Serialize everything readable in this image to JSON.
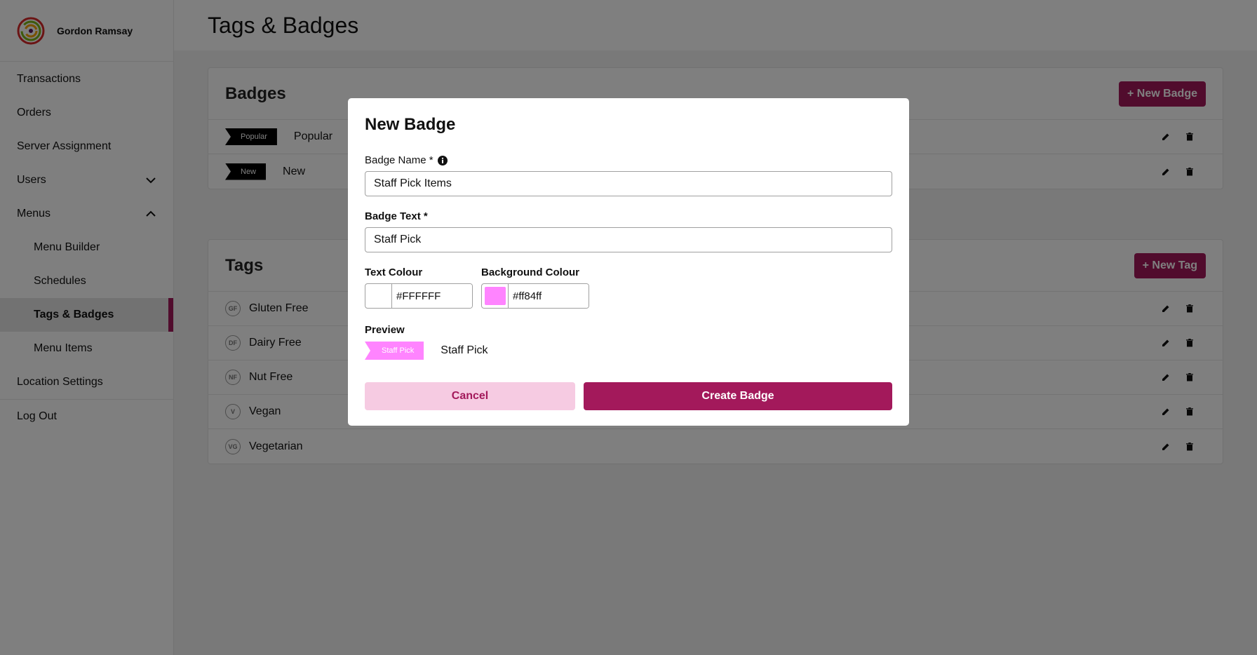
{
  "brand": {
    "name": "Gordon Ramsay"
  },
  "sidebar": {
    "items": [
      {
        "label": "Transactions"
      },
      {
        "label": "Orders"
      },
      {
        "label": "Server Assignment"
      },
      {
        "label": "Users"
      },
      {
        "label": "Menus"
      },
      {
        "label": "Menu Builder"
      },
      {
        "label": "Schedules"
      },
      {
        "label": "Tags & Badges"
      },
      {
        "label": "Menu Items"
      },
      {
        "label": "Location Settings"
      },
      {
        "label": "Log Out"
      }
    ]
  },
  "header": {
    "title": "Tags & Badges"
  },
  "badges": {
    "title": "Badges",
    "new_button": "+ New Badge",
    "rows": [
      {
        "badge_text": "Popular",
        "name": "Popular"
      },
      {
        "badge_text": "New",
        "name": "New"
      }
    ]
  },
  "tags": {
    "title": "Tags",
    "new_button": "+ New Tag",
    "rows": [
      {
        "abbr": "GF",
        "name": "Gluten Free"
      },
      {
        "abbr": "DF",
        "name": "Dairy Free"
      },
      {
        "abbr": "NF",
        "name": "Nut Free"
      },
      {
        "abbr": "V",
        "name": "Vegan"
      },
      {
        "abbr": "VG",
        "name": "Vegetarian"
      }
    ]
  },
  "modal": {
    "title": "New Badge",
    "badge_name_label": "Badge Name *",
    "badge_name_value": "Staff Pick Items",
    "badge_text_label": "Badge Text *",
    "badge_text_value": "Staff Pick",
    "text_colour_label": "Text Colour",
    "text_colour_value": "#FFFFFF",
    "background_colour_label": "Background Colour",
    "background_colour_value": "#ff84ff",
    "preview_label": "Preview",
    "preview_badge_text": "Staff Pick",
    "preview_name": "Staff Pick",
    "cancel_label": "Cancel",
    "create_label": "Create Badge"
  },
  "colors": {
    "accent": "#a3195b",
    "cancel_bg": "#f6cbe2",
    "preview_bg": "#ff84ff",
    "preview_text": "#FFFFFF"
  }
}
